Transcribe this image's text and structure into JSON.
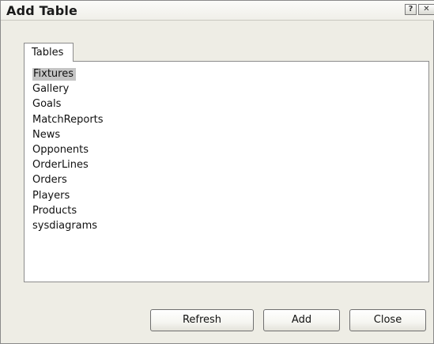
{
  "window": {
    "title": "Add Table",
    "help_glyph": "?",
    "close_glyph": "✕"
  },
  "tabs": [
    {
      "label": "Tables",
      "active": true
    }
  ],
  "tables_list": {
    "selected_index": 0,
    "items": [
      "Fixtures",
      "Gallery",
      "Goals",
      "MatchReports",
      "News",
      "Opponents",
      "OrderLines",
      "Orders",
      "Players",
      "Products",
      "sysdiagrams"
    ]
  },
  "buttons": {
    "refresh": "Refresh",
    "add": "Add",
    "close": "Close"
  },
  "icons": {
    "help": "help-icon",
    "close": "close-icon"
  },
  "colors": {
    "dialog_bg": "#eeede5",
    "selection_bg": "#c5c5c5"
  }
}
